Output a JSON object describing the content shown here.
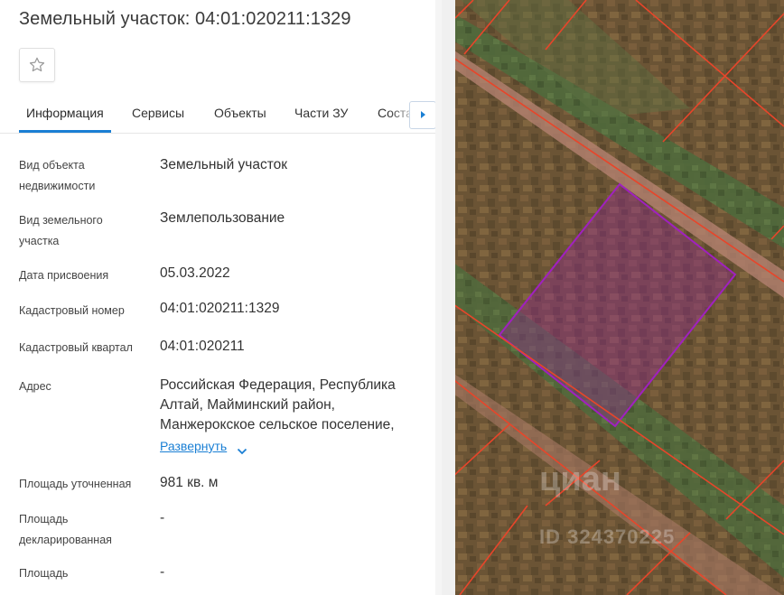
{
  "title": "Земельный участок: 04:01:020211:1329",
  "tabs": [
    {
      "label": "Информация",
      "active": true
    },
    {
      "label": "Сервисы"
    },
    {
      "label": "Объекты"
    },
    {
      "label": "Части ЗУ"
    },
    {
      "label": "Соста"
    }
  ],
  "icons": {
    "favorite": "star-icon",
    "next": "chevron-right-icon",
    "expand": "chevron-down-icon"
  },
  "fields": [
    {
      "label": "Вид объекта недвижимости",
      "value": "Земельный участок"
    },
    {
      "label": "Вид земельного участка",
      "value": "Землепользование"
    },
    {
      "label": "Дата присвоения",
      "value": "05.03.2022"
    },
    {
      "label": "Кадастровый номер",
      "value": "04:01:020211:1329"
    },
    {
      "label": "Кадастровый квартал",
      "value": "04:01:020211"
    },
    {
      "label": "Адрес",
      "value": "Российская Федерация, Республика Алтай, Майминский район, Манжерокское сельское поселение,"
    },
    {
      "label": "Площадь уточненная",
      "value": "981 кв. м"
    },
    {
      "label": "Площадь декларированная",
      "value": "-"
    },
    {
      "label": "Площадь",
      "value": "-"
    }
  ],
  "expand_label": "Развернуть",
  "watermark": {
    "brand": "циан",
    "id": "ID 324370225"
  },
  "colors": {
    "accent": "#1a7fd4",
    "parcel_outline": "#a020c0",
    "boundary": "#e8452a",
    "road": "#c08a7a"
  }
}
